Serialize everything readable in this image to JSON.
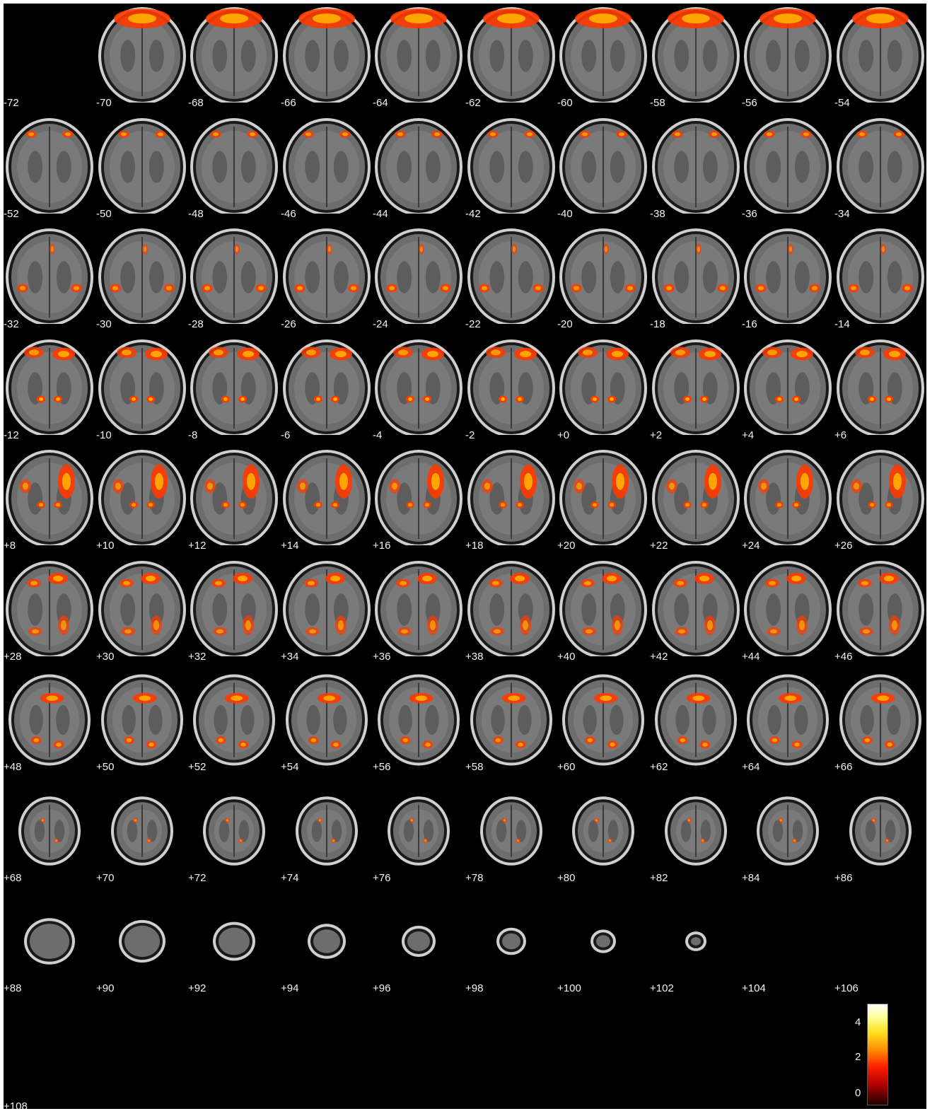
{
  "slice_labels": [
    "-72",
    "-70",
    "-68",
    "-66",
    "-64",
    "-62",
    "-60",
    "-58",
    "-56",
    "-54",
    "-52",
    "-50",
    "-48",
    "-46",
    "-44",
    "-42",
    "-40",
    "-38",
    "-36",
    "-34",
    "-32",
    "-30",
    "-28",
    "-26",
    "-24",
    "-22",
    "-20",
    "-18",
    "-16",
    "-14",
    "-12",
    "-10",
    "-8",
    "-6",
    "-4",
    "-2",
    "+0",
    "+2",
    "+4",
    "+6",
    "+8",
    "+10",
    "+12",
    "+14",
    "+16",
    "+18",
    "+20",
    "+22",
    "+24",
    "+26",
    "+28",
    "+30",
    "+32",
    "+34",
    "+36",
    "+38",
    "+40",
    "+42",
    "+44",
    "+46",
    "+48",
    "+50",
    "+52",
    "+54",
    "+56",
    "+58",
    "+60",
    "+62",
    "+64",
    "+66",
    "+68",
    "+70",
    "+72",
    "+74",
    "+76",
    "+78",
    "+80",
    "+82",
    "+84",
    "+86",
    "+88",
    "+90",
    "+92",
    "+94",
    "+96",
    "+98",
    "+100",
    "+102",
    "+104",
    "+106",
    "+108"
  ],
  "colorbar": {
    "ticks": [
      "4",
      "2",
      "0"
    ],
    "colors": [
      "#ffffff",
      "#ffff80",
      "#ffc000",
      "#ff6000",
      "#e00000",
      "#400000"
    ]
  }
}
